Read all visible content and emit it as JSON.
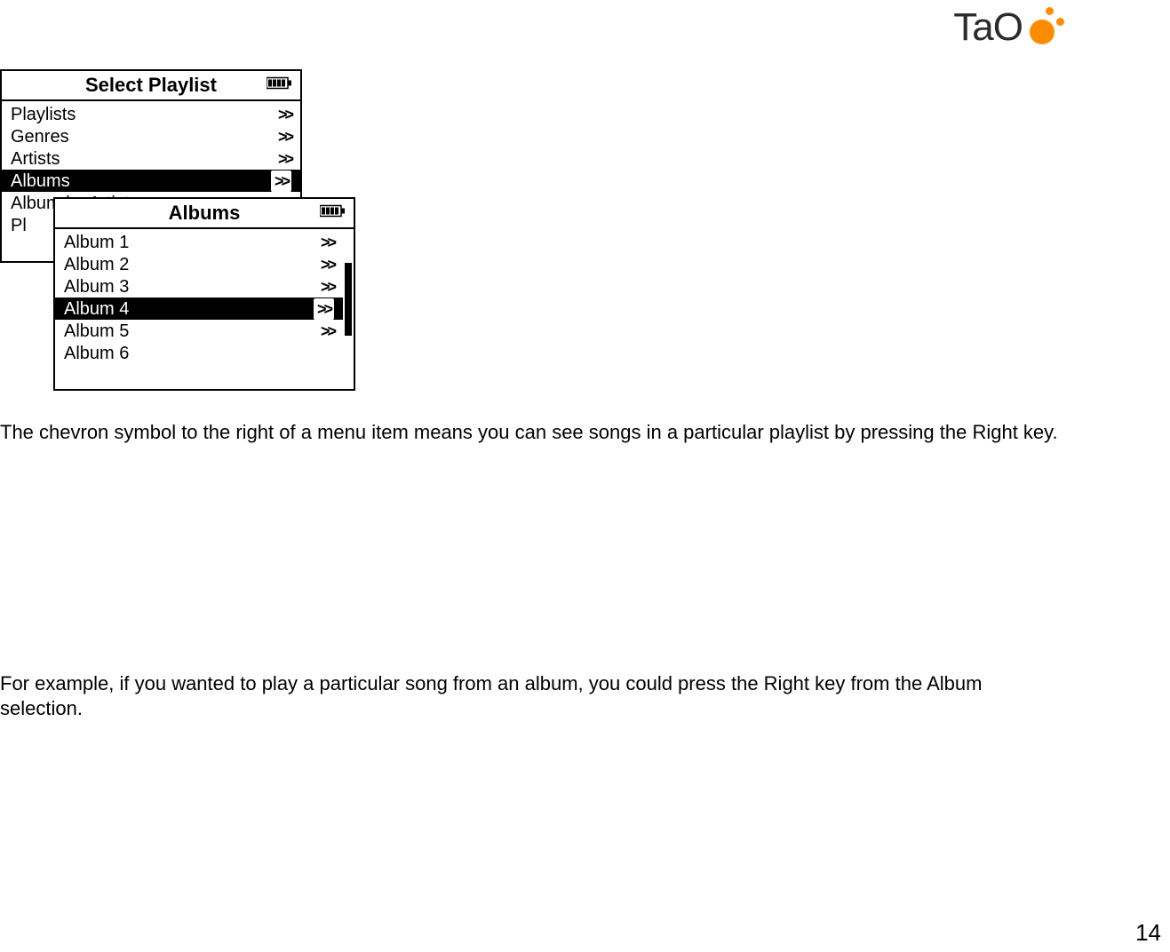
{
  "logo": {
    "text": "TaO"
  },
  "screens": {
    "back": {
      "title": "Select Playlist",
      "items": [
        {
          "label": "Playlists",
          "chev": ">>",
          "selected": false
        },
        {
          "label": "Genres",
          "chev": ">>",
          "selected": false
        },
        {
          "label": "Artists",
          "chev": ">>",
          "selected": false
        },
        {
          "label": "Albums",
          "chev": ">>",
          "selected": true
        },
        {
          "label": "Album by Artist",
          "chev": ">>",
          "selected": false
        },
        {
          "label": "Pl",
          "chev": "",
          "selected": false
        }
      ]
    },
    "front": {
      "title": "Albums",
      "items": [
        {
          "label": "Album 1",
          "chev": ">>",
          "selected": false
        },
        {
          "label": "Album 2",
          "chev": ">>",
          "selected": false
        },
        {
          "label": "Album 3",
          "chev": ">>",
          "selected": false
        },
        {
          "label": "Album 4",
          "chev": ">>",
          "selected": true
        },
        {
          "label": "Album 5",
          "chev": ">>",
          "selected": false
        },
        {
          "label": "Album 6",
          "chev": "",
          "selected": false
        }
      ]
    }
  },
  "paragraphs": {
    "p1": "The chevron symbol to the right of a menu item means you can see songs in a particular playlist by pressing the Right key.",
    "p2": "For example, if you wanted to play a particular song from an album, you could press the Right key from the Album selection."
  },
  "pageNumber": "14"
}
